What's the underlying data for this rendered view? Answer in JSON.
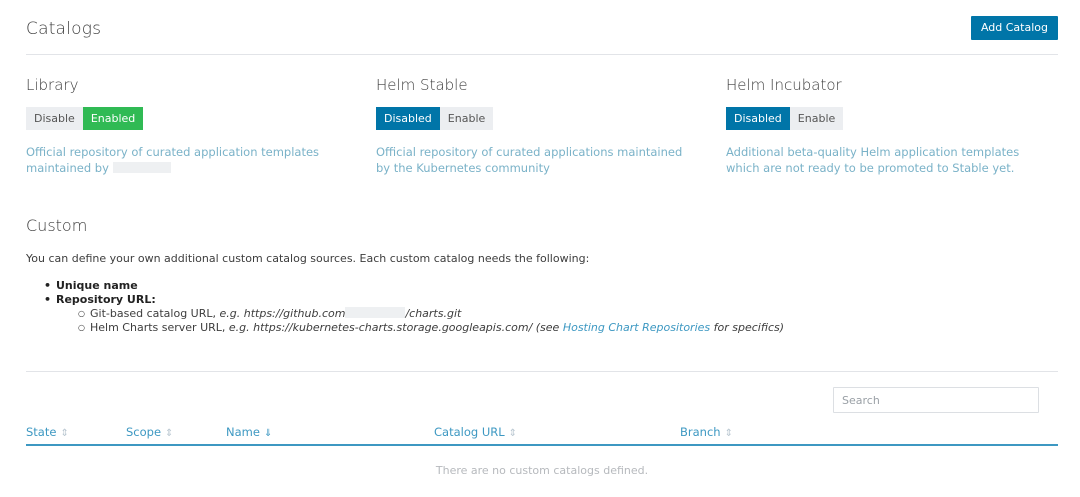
{
  "header": {
    "title": "Catalogs",
    "add_button": "Add Catalog"
  },
  "catalogs": [
    {
      "name": "Library",
      "left_label": "Disable",
      "right_label": "Enabled",
      "description": "Official repository of curated application templates maintained by"
    },
    {
      "name": "Helm Stable",
      "left_label": "Disabled",
      "right_label": "Enable",
      "description": "Official repository of curated applications maintained by the Kubernetes community"
    },
    {
      "name": "Helm Incubator",
      "left_label": "Disabled",
      "right_label": "Enable",
      "description": "Additional beta-quality Helm application templates which are not ready to be promoted to Stable yet."
    }
  ],
  "custom": {
    "title": "Custom",
    "description": "You can define your own additional custom catalog sources. Each custom catalog needs the following:",
    "req_name": "Unique name",
    "req_url": "Repository URL:",
    "git_prefix": "Git-based catalog URL, ",
    "git_eg": "e.g. https://github.com",
    "git_suffix": "/charts.git",
    "helm_prefix": "Helm Charts server URL, ",
    "helm_eg": "e.g. https://kubernetes-charts.storage.googleapis.com/ (see ",
    "helm_link": "Hosting Chart Repositories",
    "helm_suffix": " for specifics)"
  },
  "search": {
    "placeholder": "Search"
  },
  "table": {
    "columns": [
      "State",
      "Scope",
      "Name",
      "Catalog URL",
      "Branch"
    ],
    "empty_message": "There are no custom catalogs defined."
  },
  "colors": {
    "primary": "#0075a8",
    "enabled": "#30ba54",
    "link": "#3d98c2"
  },
  "icons": {
    "sort": "sort-icon"
  }
}
